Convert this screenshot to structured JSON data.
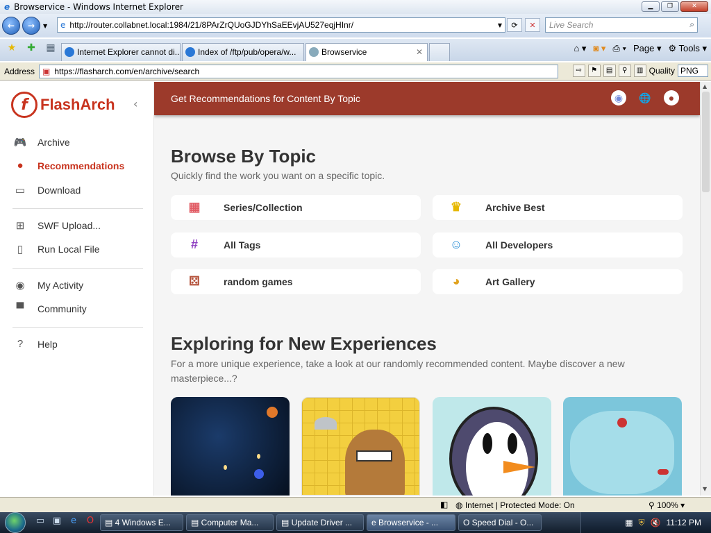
{
  "window": {
    "title": "Browservice - Windows Internet Explorer"
  },
  "ie": {
    "url": "http://router.collabnet.local:1984/21/8PArZrQUoGJDYhSaEEvjAU527eqjHInr/",
    "search_placeholder": "Live Search",
    "tabs": [
      {
        "label": "Internet Explorer cannot di..."
      },
      {
        "label": "Index of /ftp/pub/opera/w..."
      },
      {
        "label": "Browservice"
      }
    ],
    "commands": {
      "page": "Page",
      "tools": "Tools"
    }
  },
  "browservice": {
    "address_label": "Address",
    "address_value": "https://flasharch.com/en/archive/search",
    "quality_label": "Quality",
    "quality_value": "PNG"
  },
  "site": {
    "brand": "FlashArch",
    "header_title": "Get Recommendations for Content By Topic",
    "nav": [
      {
        "label": "Archive",
        "icon": "gamepad-icon"
      },
      {
        "label": "Recommendations",
        "icon": "recommend-icon"
      },
      {
        "label": "Download",
        "icon": "monitor-icon"
      },
      {
        "label": "SWF Upload...",
        "icon": "add-box-icon"
      },
      {
        "label": "Run Local File",
        "icon": "file-icon"
      },
      {
        "label": "My Activity",
        "icon": "person-icon"
      },
      {
        "label": "Community",
        "icon": "forum-icon"
      },
      {
        "label": "Help",
        "icon": "help-icon"
      }
    ],
    "browse": {
      "title": "Browse By Topic",
      "subtitle": "Quickly find the work you want on a specific topic.",
      "topics": [
        {
          "label": "Series/Collection",
          "icon": "grid-icon"
        },
        {
          "label": "Archive Best",
          "icon": "crown-icon"
        },
        {
          "label": "All Tags",
          "icon": "hashtag-icon"
        },
        {
          "label": "All Developers",
          "icon": "developer-icon"
        },
        {
          "label": "random games",
          "icon": "dice-icon"
        },
        {
          "label": "Art Gallery",
          "icon": "palette-icon"
        }
      ]
    },
    "explore": {
      "title": "Exploring for New Experiences",
      "subtitle_line1": "For a more unique experience, take a look at our randomly recommended content. Maybe discover a new",
      "subtitle_line2": "masterpiece...?"
    }
  },
  "status": {
    "zone": "Internet | Protected Mode: On",
    "zoom": "100%"
  },
  "taskbar": {
    "items": [
      {
        "label": "4 Windows E..."
      },
      {
        "label": "Computer Ma..."
      },
      {
        "label": "Update Driver ..."
      },
      {
        "label": "Browservice - ..."
      },
      {
        "label": "Speed Dial - O..."
      }
    ],
    "clock": "11:12 PM"
  },
  "colors": {
    "accent": "#c8341f",
    "header": "#9c3a2b"
  }
}
